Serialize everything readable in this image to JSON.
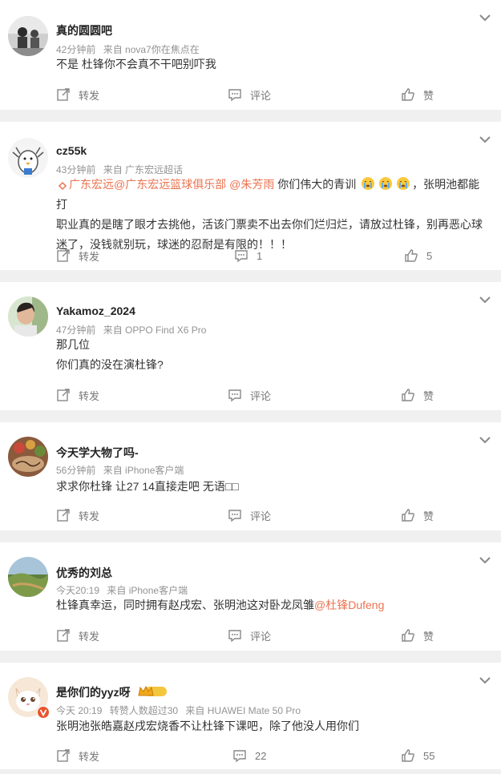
{
  "comments": [
    {
      "name": "真的圆圆吧",
      "time": "42分钟前",
      "source": "来自 nova7你在焦点在",
      "text": "不是 杜锋你不会真不干吧别吓我",
      "actions": {
        "repost": "转发",
        "comment": "评论",
        "like": "赞"
      }
    },
    {
      "name": "cz55k",
      "time": "43分钟前",
      "source": "来自 广东宏远超话",
      "mention1": "广东宏远@广东宏远篮球俱乐部",
      "mention2": "@朱芳雨",
      "text_after_mentions": " 你们伟大的青训",
      "text_after_emojis": "，张明池都能打",
      "line2": "职业真的是瞎了眼才去挑他，活该门票卖不出去你们烂归烂，请放过杜锋，别再恶心球",
      "line3": "迷了，没钱就别玩，球迷的忍耐是有限的！！！",
      "actions": {
        "repost": "转发",
        "comment": "1",
        "like": "5"
      }
    },
    {
      "name": "Yakamoz_2024",
      "time": "47分钟前",
      "source": "来自 OPPO Find X6 Pro",
      "line1": "那几位",
      "line2": "你们真的没在演杜锋?",
      "actions": {
        "repost": "转发",
        "comment": "评论",
        "like": "赞"
      }
    },
    {
      "name": "今天学大物了吗-",
      "time": "56分钟前",
      "source": "来自 iPhone客户端",
      "text": "求求你杜锋 让27 14直接走吧 无语□□",
      "actions": {
        "repost": "转发",
        "comment": "评论",
        "like": "赞"
      }
    },
    {
      "name": "优秀的刘总",
      "time": "今天20:19",
      "source": "来自 iPhone客户端",
      "text": "杜锋真幸运，同时拥有赵戌宏、张明池这对卧龙凤雏",
      "mention": "@杜锋Dufeng",
      "actions": {
        "repost": "转发",
        "comment": "评论",
        "like": "赞"
      }
    },
    {
      "name": "是你们的yyz呀",
      "badge": "II",
      "time": "今天 20:19",
      "hot": "转赞人数超过30",
      "source": "来自 HUAWEI Mate 50 Pro",
      "text": "张明池张皓嘉赵戌宏烧香不让杜锋下课吧，除了他没人用你们",
      "actions": {
        "repost": "转发",
        "comment": "22",
        "like": "55"
      }
    }
  ],
  "colors": {
    "link": "#eb7350",
    "meta": "#939393",
    "background": "#f0f0f0"
  },
  "icons": [
    "avatar",
    "chevron-down-icon",
    "repost-icon",
    "comment-icon",
    "like-icon",
    "crying-emoji-icon",
    "crown-badge-icon",
    "verified-v-icon",
    "link-chain-icon"
  ]
}
